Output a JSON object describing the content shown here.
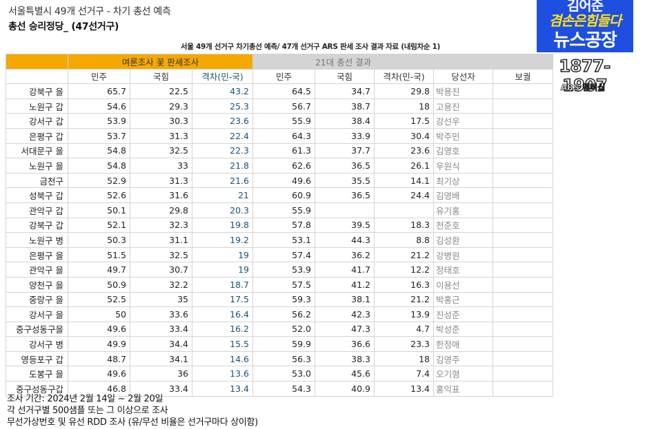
{
  "header": {
    "title": "서울특별시 49개 선거구 - 차기 총선 예측",
    "subtitle": "총선 승리정당_ (47선거구)",
    "table_title": "서울 49개 선거구 차기총선 예측/ 47개 선거구 ARS 판세 조사 결과 자료 (내림차순 1)"
  },
  "logo": {
    "line1": "김어준",
    "line2": "겸손은힘들다",
    "line3": "뉴스공장",
    "phone": "1877-1907",
    "ars": "ARS 멤버십",
    "color": "#1f4fe0"
  },
  "table": {
    "group_poll": "여론조사 꽃 판세조사",
    "group_result": "21대 총선 결과",
    "headers": [
      "민주",
      "국힘",
      "격차(민-국)",
      "민주",
      "국힘",
      "격차(민-국)",
      "당선자",
      "보궐"
    ],
    "rows": [
      {
        "district": "강북구 을",
        "p_dem": "65.7",
        "p_ppp": "22.5",
        "p_gap": "43.2",
        "r_dem": "64.5",
        "r_ppp": "34.7",
        "r_gap": "29.8",
        "winner": "박용진",
        "by": ""
      },
      {
        "district": "노원구 갑",
        "p_dem": "54.6",
        "p_ppp": "29.3",
        "p_gap": "25.3",
        "r_dem": "56.7",
        "r_ppp": "38.7",
        "r_gap": "18",
        "winner": "고용진",
        "by": ""
      },
      {
        "district": "강서구 갑",
        "p_dem": "53.9",
        "p_ppp": "30.3",
        "p_gap": "23.6",
        "r_dem": "55.9",
        "r_ppp": "38.4",
        "r_gap": "17.5",
        "winner": "강선우",
        "by": ""
      },
      {
        "district": "은평구 갑",
        "p_dem": "53.7",
        "p_ppp": "31.3",
        "p_gap": "22.4",
        "r_dem": "64.3",
        "r_ppp": "33.9",
        "r_gap": "30.4",
        "winner": "박주민",
        "by": ""
      },
      {
        "district": "서대문구 을",
        "p_dem": "54.8",
        "p_ppp": "32.5",
        "p_gap": "22.3",
        "r_dem": "61.3",
        "r_ppp": "37.7",
        "r_gap": "23.6",
        "winner": "김영호",
        "by": ""
      },
      {
        "district": "노원구 을",
        "p_dem": "54.8",
        "p_ppp": "33",
        "p_gap": "21.8",
        "r_dem": "62.6",
        "r_ppp": "36.5",
        "r_gap": "26.1",
        "winner": "우원식",
        "by": ""
      },
      {
        "district": "금천구",
        "p_dem": "52.9",
        "p_ppp": "31.3",
        "p_gap": "21.6",
        "r_dem": "49.6",
        "r_ppp": "35.5",
        "r_gap": "14.1",
        "winner": "최기상",
        "by": ""
      },
      {
        "district": "성북구 갑",
        "p_dem": "52.6",
        "p_ppp": "31.6",
        "p_gap": "21",
        "r_dem": "60.9",
        "r_ppp": "36.5",
        "r_gap": "24.4",
        "winner": "김영배",
        "by": ""
      },
      {
        "district": "관악구 갑",
        "p_dem": "50.1",
        "p_ppp": "29.8",
        "p_gap": "20.3",
        "r_dem": "55.9",
        "r_ppp": "",
        "r_gap": "",
        "winner": "유기홍",
        "by": ""
      },
      {
        "district": "강북구 갑",
        "p_dem": "52.1",
        "p_ppp": "32.3",
        "p_gap": "19.8",
        "r_dem": "57.8",
        "r_ppp": "39.5",
        "r_gap": "18.3",
        "winner": "천준호",
        "by": ""
      },
      {
        "district": "노원구 병",
        "p_dem": "50.3",
        "p_ppp": "31.1",
        "p_gap": "19.2",
        "r_dem": "53.1",
        "r_ppp": "44.3",
        "r_gap": "8.8",
        "winner": "김성환",
        "by": ""
      },
      {
        "district": "은평구 을",
        "p_dem": "51.5",
        "p_ppp": "32.5",
        "p_gap": "19",
        "r_dem": "57.4",
        "r_ppp": "36.2",
        "r_gap": "21.2",
        "winner": "강병원",
        "by": ""
      },
      {
        "district": "관악구 을",
        "p_dem": "49.7",
        "p_ppp": "30.7",
        "p_gap": "19",
        "r_dem": "53.9",
        "r_ppp": "41.7",
        "r_gap": "12.2",
        "winner": "정태호",
        "by": ""
      },
      {
        "district": "양천구 을",
        "p_dem": "50.9",
        "p_ppp": "32.2",
        "p_gap": "18.7",
        "r_dem": "57.5",
        "r_ppp": "41.2",
        "r_gap": "16.3",
        "winner": "이용선",
        "by": ""
      },
      {
        "district": "중랑구 을",
        "p_dem": "52.5",
        "p_ppp": "35",
        "p_gap": "17.5",
        "r_dem": "59.3",
        "r_ppp": "38.1",
        "r_gap": "21.2",
        "winner": "박홍근",
        "by": ""
      },
      {
        "district": "강서구 을",
        "p_dem": "50",
        "p_ppp": "33.6",
        "p_gap": "16.4",
        "r_dem": "56.2",
        "r_ppp": "42.3",
        "r_gap": "13.9",
        "winner": "진성준",
        "by": ""
      },
      {
        "district": "중구성동구을",
        "p_dem": "49.6",
        "p_ppp": "33.4",
        "p_gap": "16.2",
        "r_dem": "52.0",
        "r_ppp": "47.3",
        "r_gap": "4.7",
        "winner": "박성준",
        "by": ""
      },
      {
        "district": "강서구 병",
        "p_dem": "49.9",
        "p_ppp": "34.4",
        "p_gap": "15.5",
        "r_dem": "59.9",
        "r_ppp": "36.6",
        "r_gap": "23.3",
        "winner": "한정애",
        "by": ""
      },
      {
        "district": "영등포구 갑",
        "p_dem": "48.7",
        "p_ppp": "34.1",
        "p_gap": "14.6",
        "r_dem": "56.3",
        "r_ppp": "38.3",
        "r_gap": "18",
        "winner": "김영주",
        "by": ""
      },
      {
        "district": "도봉구 을",
        "p_dem": "49.6",
        "p_ppp": "36",
        "p_gap": "13.6",
        "r_dem": "53.0",
        "r_ppp": "45.6",
        "r_gap": "7.4",
        "winner": "오기형",
        "by": ""
      },
      {
        "district": "중구성동구갑",
        "p_dem": "46.8",
        "p_ppp": "33.4",
        "p_gap": "13.4",
        "r_dem": "54.3",
        "r_ppp": "40.9",
        "r_gap": "13.4",
        "winner": "홍익표",
        "by": ""
      }
    ]
  },
  "notes": {
    "line1": "조사 기간:  2024년 2월 14일 ~ 2월 20일",
    "line2": "각 선거구별 500샘플 또는 그 이상으로 조사",
    "line3": "무선가상번호 및 유선 RDD 조사 (유/무선 비율은 선거구마다 상이함)"
  },
  "colors": {
    "poll_header": "#f5a800",
    "result_header": "#d4d4d4",
    "gap_text": "#1a5276"
  }
}
